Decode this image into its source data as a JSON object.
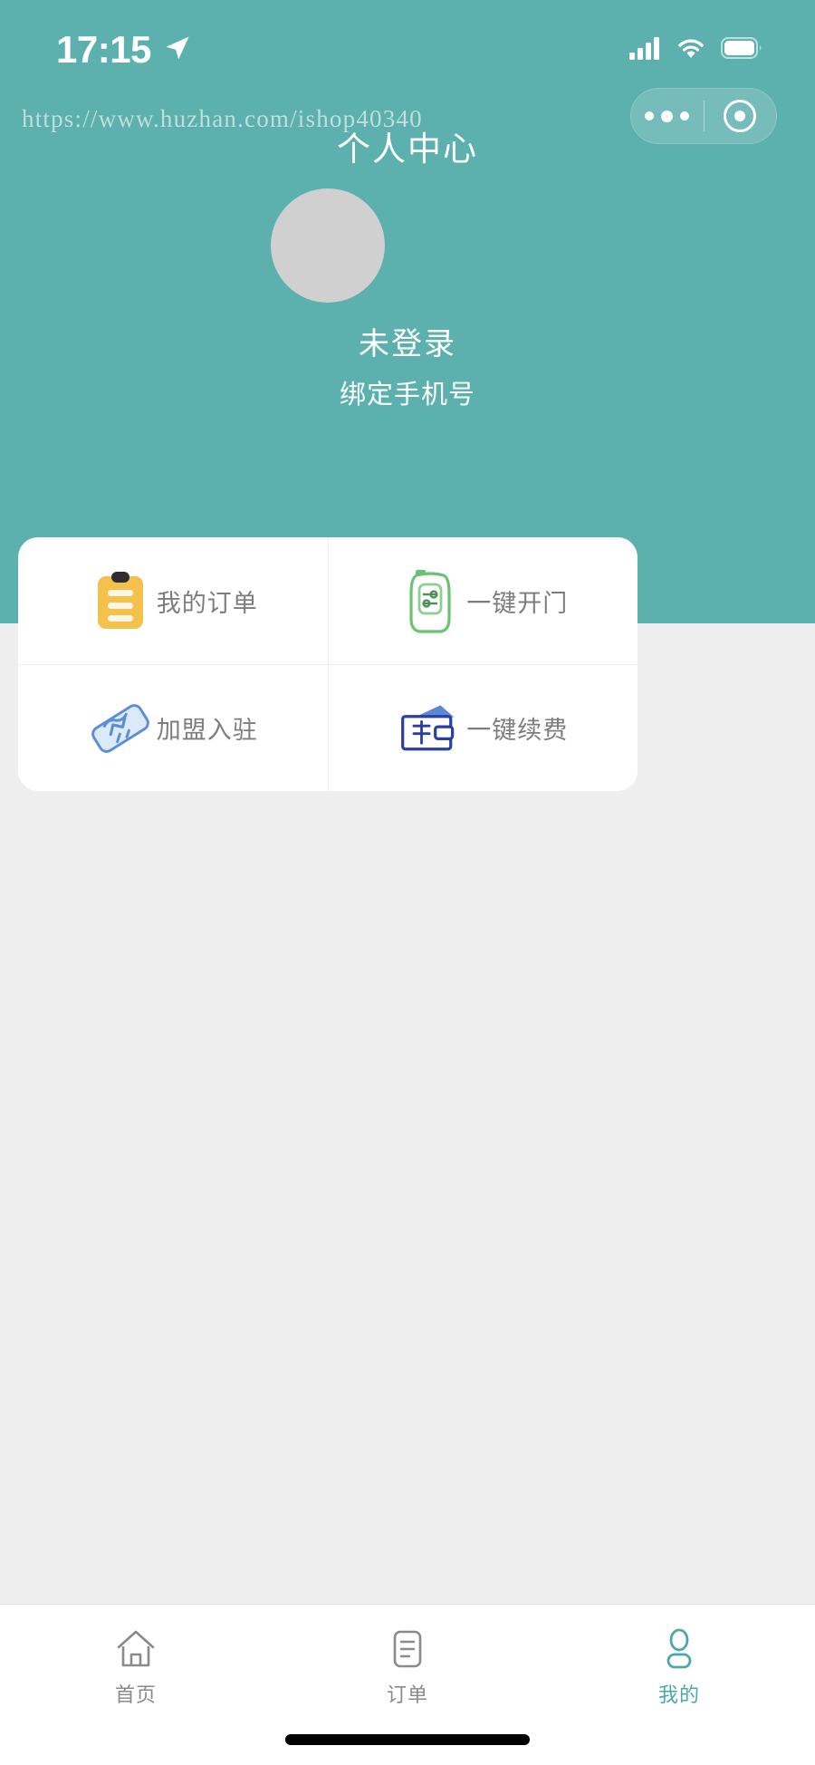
{
  "status_bar": {
    "time": "17:15",
    "location_icon": "location-arrow-icon",
    "signal_icon": "cellular-signal-icon",
    "wifi_icon": "wifi-icon",
    "battery_icon": "battery-icon"
  },
  "watermark": {
    "text": "https://www.huzhan.com/ishop40340"
  },
  "nav": {
    "title": "个人中心",
    "capsule": {
      "more_icon": "more-dots-icon",
      "target_icon": "mini-program-target-icon"
    }
  },
  "profile": {
    "avatar_icon": "default-avatar-icon",
    "nickname": "未登录",
    "bind_phone_label": "绑定手机号"
  },
  "grid": {
    "items": [
      {
        "label": "我的订单",
        "icon": "clipboard-order-icon"
      },
      {
        "label": "一键开门",
        "icon": "remote-door-icon"
      },
      {
        "label": "加盟入驻",
        "icon": "handshake-join-icon"
      },
      {
        "label": "一键续费",
        "icon": "wallet-renew-icon"
      }
    ]
  },
  "tabbar": {
    "items": [
      {
        "label": "首页",
        "icon": "home-icon",
        "active": false
      },
      {
        "label": "订单",
        "icon": "order-list-icon",
        "active": false
      },
      {
        "label": "我的",
        "icon": "user-profile-icon",
        "active": true
      }
    ]
  },
  "colors": {
    "brand_teal": "#5cb0ae",
    "active_tab": "#4aa9a8",
    "page_bg": "#eeeeee",
    "card_bg": "#ffffff",
    "order_icon": "#f3c04b",
    "door_icon": "#6cc273",
    "join_icon": "#5a8fd8",
    "renew_icon": "#2b3fa0",
    "avatar_bg": "#d0d0d0"
  }
}
